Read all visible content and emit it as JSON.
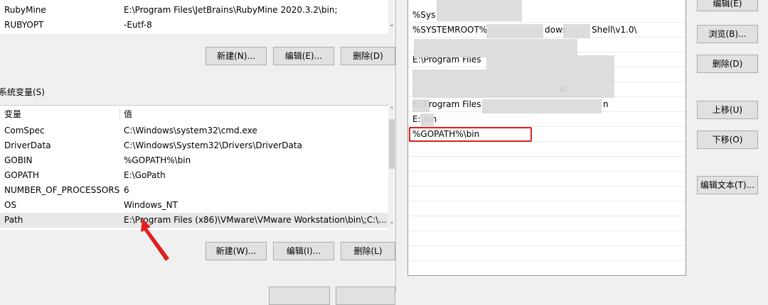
{
  "user_vars": {
    "rows": [
      {
        "name": "RubyMine",
        "value": "E:\\Program Files\\JetBrains\\RubyMine 2020.3.2\\bin;"
      },
      {
        "name": "RUBYOPT",
        "value": "-Eutf-8"
      }
    ],
    "buttons": {
      "new": "新建(N)...",
      "edit": "编辑(E)...",
      "delete": "删除(D)"
    }
  },
  "system_vars": {
    "section_label": "系统变量(S)",
    "col_var": "变量",
    "col_val": "值",
    "rows": [
      {
        "name": "ComSpec",
        "value": "C:\\Windows\\system32\\cmd.exe"
      },
      {
        "name": "DriverData",
        "value": "C:\\Windows\\System32\\Drivers\\DriverData"
      },
      {
        "name": "GOBIN",
        "value": "%GOPATH%\\bin"
      },
      {
        "name": "GOPATH",
        "value": "E:\\GoPath"
      },
      {
        "name": "NUMBER_OF_PROCESSORS",
        "value": "6"
      },
      {
        "name": "OS",
        "value": "Windows_NT"
      },
      {
        "name": "Path",
        "value": "E:\\Program Files (x86)\\VMware\\VMware Workstation\\bin\\;C:\\..."
      }
    ],
    "buttons": {
      "new": "新建(W)...",
      "edit": "编辑(I)...",
      "delete": "删除(L)"
    }
  },
  "edit_path_dialog": {
    "items": [
      "%Sys",
      "%SYSTEMROOT%",
      "",
      "E:\\Program Files",
      "",
      "",
      "E:\\Program Files",
      "E:\\bin",
      "%GOPATH%\\bin",
      "",
      "",
      "",
      "",
      "",
      "",
      "",
      "",
      "",
      ""
    ],
    "item_fragments": {
      "a": "dows",
      "b": "Shell\\v1.0\\",
      "c": "al",
      "d": "n"
    },
    "highlighted_item": "%GOPATH%\\bin",
    "buttons": {
      "edit": "编辑(E)",
      "browse": "浏览(B)...",
      "delete": "删除(D)",
      "move_up": "上移(U)",
      "move_down": "下移(O)",
      "edit_text": "编辑文本(T)..."
    }
  },
  "colors": {
    "highlight_box": "#e02020",
    "arrow": "#e02020"
  }
}
